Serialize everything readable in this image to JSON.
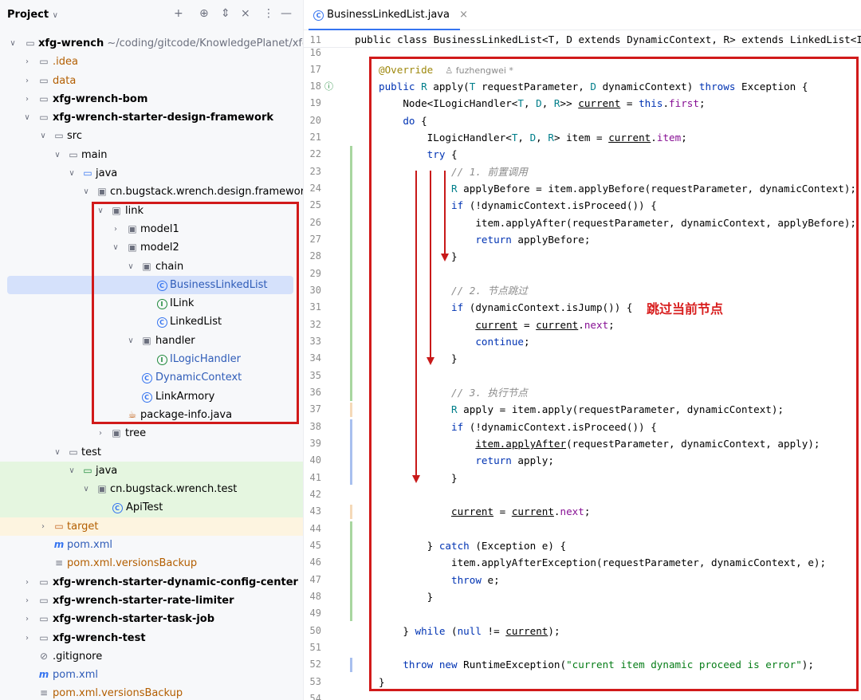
{
  "project": {
    "title": "Project",
    "items": [
      {
        "label": "xfg-wrench",
        "path": "~/coding/gitcode/KnowledgePlanet/xfg-wre"
      },
      {
        "label": ".idea"
      },
      {
        "label": "data"
      },
      {
        "label": "xfg-wrench-bom"
      },
      {
        "label": "xfg-wrench-starter-design-framework"
      },
      {
        "label": "src"
      },
      {
        "label": "main"
      },
      {
        "label": "java"
      },
      {
        "label": "cn.bugstack.wrench.design.framework"
      },
      {
        "label": "link"
      },
      {
        "label": "model1"
      },
      {
        "label": "model2"
      },
      {
        "label": "chain"
      },
      {
        "label": "BusinessLinkedList"
      },
      {
        "label": "ILink"
      },
      {
        "label": "LinkedList"
      },
      {
        "label": "handler"
      },
      {
        "label": "ILogicHandler"
      },
      {
        "label": "DynamicContext"
      },
      {
        "label": "LinkArmory"
      },
      {
        "label": "package-info.java"
      },
      {
        "label": "tree"
      },
      {
        "label": "test"
      },
      {
        "label": "java"
      },
      {
        "label": "cn.bugstack.wrench.test"
      },
      {
        "label": "ApiTest"
      },
      {
        "label": "target"
      },
      {
        "label": "pom.xml"
      },
      {
        "label": "pom.xml.versionsBackup"
      },
      {
        "label": "xfg-wrench-starter-dynamic-config-center"
      },
      {
        "label": "xfg-wrench-starter-rate-limiter"
      },
      {
        "label": "xfg-wrench-starter-task-job"
      },
      {
        "label": "xfg-wrench-test"
      },
      {
        "label": ".gitignore"
      },
      {
        "label": "pom.xml"
      },
      {
        "label": "pom.xml.versionsBackup"
      }
    ]
  },
  "editor": {
    "tab_label": "BusinessLinkedList.java",
    "sticky_line": "11",
    "sticky_code": "public class BusinessLinkedList<T, D extends DynamicContext, R> extends LinkedList<I",
    "author": "fuzhengwei *",
    "annotation": "跳过当前节点",
    "line_numbers": [
      "16",
      "17",
      "18",
      "19",
      "20",
      "21",
      "22",
      "23",
      "24",
      "25",
      "26",
      "27",
      "28",
      "29",
      "30",
      "31",
      "32",
      "33",
      "34",
      "35",
      "36",
      "37",
      "38",
      "39",
      "40",
      "41",
      "42",
      "43",
      "44",
      "45",
      "46",
      "47",
      "48",
      "49",
      "50",
      "51",
      "52",
      "53",
      "54"
    ]
  },
  "colors": {
    "highlight_box": "#d11a1a",
    "annotation": "#d81e1e",
    "accent": "#3574f0"
  }
}
